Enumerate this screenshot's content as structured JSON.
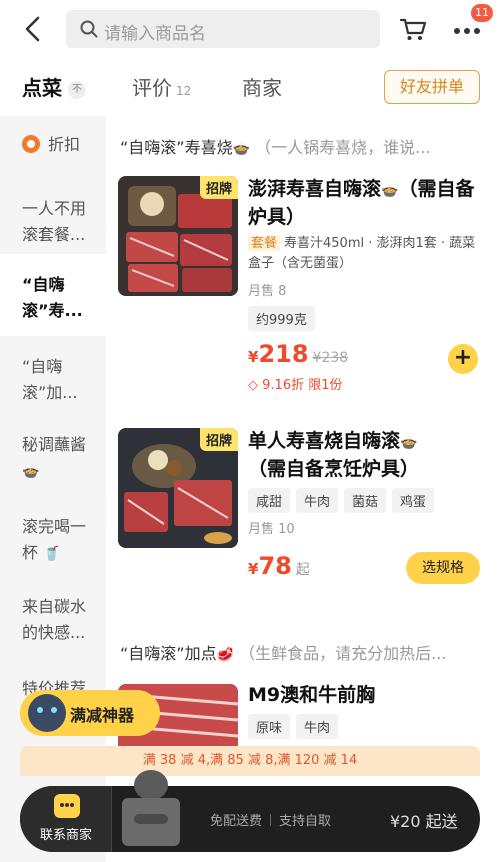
{
  "topbar": {
    "search_placeholder": "请输入商品名",
    "notification_count": "11"
  },
  "tabs": {
    "order": "点菜",
    "reviews": "评价",
    "reviews_count": "12",
    "merchant": "商家",
    "group_order": "好友拼单"
  },
  "sidebar": {
    "items": [
      "折扣",
      "一人不用滚套餐...",
      "“自嗨滚”寿...",
      "“自嗨滚”加...",
      "秘调蘸酱",
      "滚完喝一杯",
      "来自碳水的快感...",
      "特价推荐"
    ]
  },
  "sections": {
    "s1_title": "“自嗨滚”寿喜烧",
    "s1_note": "（一人锅寿喜烧，谁说...",
    "s2_title": "“自嗨滚”加点",
    "s2_note": "（生鲜食品，请充分加热后..."
  },
  "item1": {
    "tag": "招牌",
    "name": "澎湃寿喜自嗨滚",
    "name2": "（需自备炉具）",
    "set_label": "套餐",
    "desc": "寿喜汁450ml · 澎湃肉1套 · 蔬菜盒子（含无菌蛋）",
    "sold": "月售 8",
    "weight": "约999克",
    "currency": "¥",
    "price": "218",
    "orig_price": "¥238",
    "discount": "9.16折 限1份"
  },
  "item2": {
    "tag": "招牌",
    "name": "单人寿喜烧自嗨滚",
    "name2": "（需自备烹饪炉具）",
    "chips": [
      "咸甜",
      "牛肉",
      "菌菇",
      "鸡蛋"
    ],
    "sold": "月售 10",
    "currency": "¥",
    "price": "78",
    "from": "起",
    "spec_btn": "选规格"
  },
  "item3": {
    "name": "M9澳和牛前胸",
    "chips": [
      "原味",
      "牛肉"
    ]
  },
  "promo": {
    "float_label": "满减神器",
    "strip": "满 38 减 4,满 85 减 8,满 120 减 14"
  },
  "bottombar": {
    "contact": "联系商家",
    "free_delivery": "免配送费",
    "pickup": "支持自取",
    "min_order": "¥20 起送"
  }
}
